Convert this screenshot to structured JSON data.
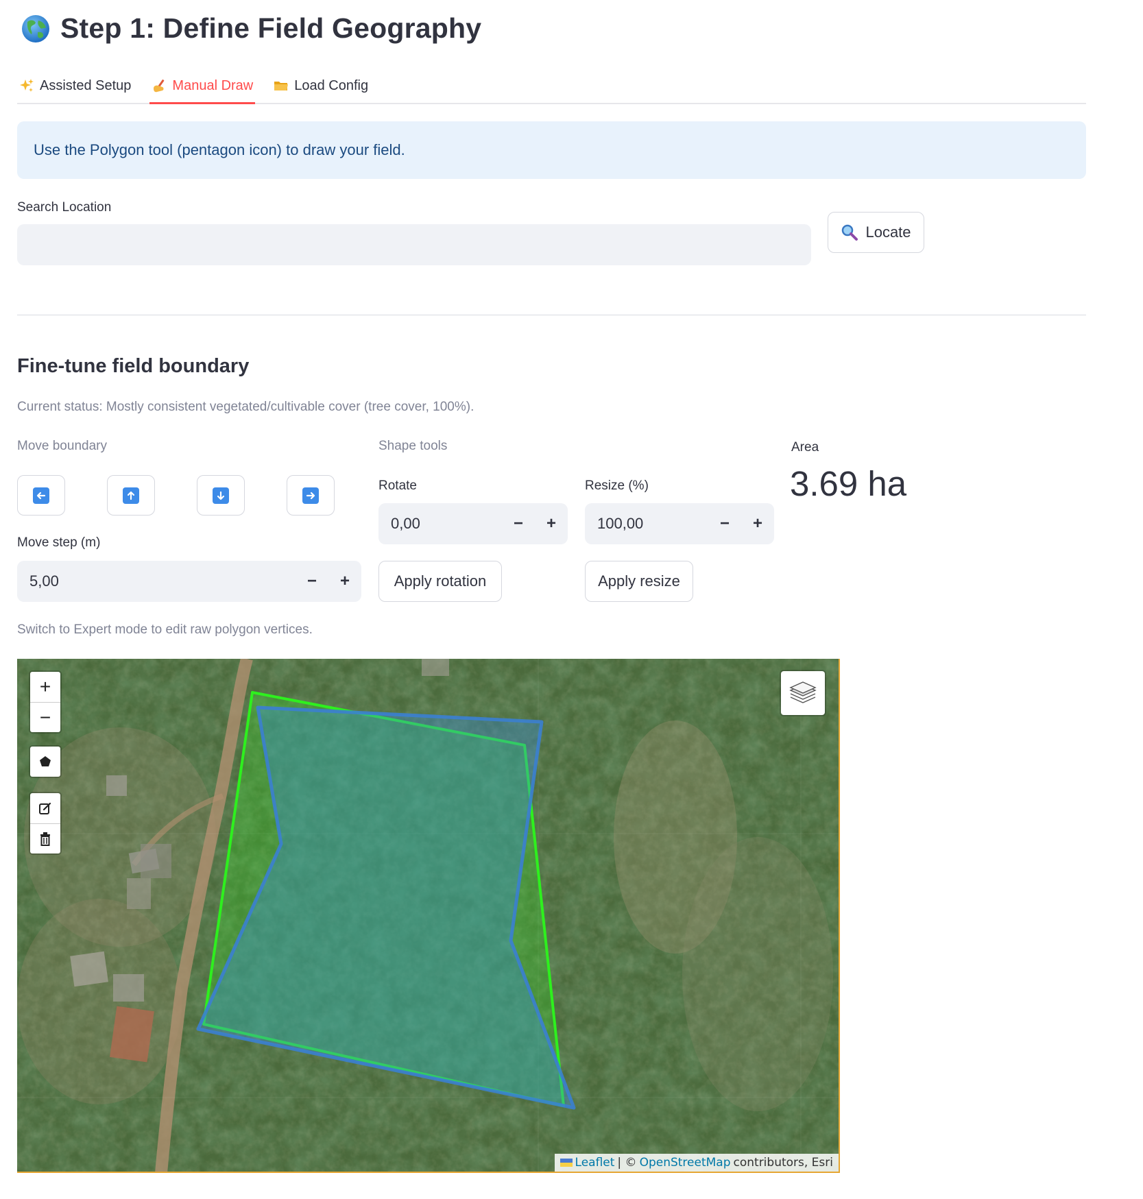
{
  "page": {
    "title": "Step 1: Define Field Geography"
  },
  "tabs": [
    {
      "label": "Assisted Setup",
      "icon": "sparkles-icon",
      "active": false
    },
    {
      "label": "Manual Draw",
      "icon": "writing-hand-icon",
      "active": true
    },
    {
      "label": "Load Config",
      "icon": "folder-icon",
      "active": false
    }
  ],
  "info": {
    "message": "Use the Polygon tool (pentagon icon) to draw your field."
  },
  "search": {
    "label": "Search Location",
    "value": "",
    "placeholder": "",
    "button_label": "Locate"
  },
  "finetune": {
    "title": "Fine-tune field boundary",
    "status": "Current status: Mostly consistent vegetated/cultivable cover (tree cover, 100%).",
    "move_label": "Move boundary",
    "move_step_label": "Move step (m)",
    "move_step_value": "5,00",
    "shape_tools_label": "Shape tools",
    "rotate_label": "Rotate",
    "rotate_value": "0,00",
    "resize_label": "Resize (%)",
    "resize_value": "100,00",
    "apply_rotation_label": "Apply rotation",
    "apply_resize_label": "Apply resize",
    "minus": "−",
    "plus": "+"
  },
  "area": {
    "label": "Area",
    "value": "3.69 ha"
  },
  "expert_hint": "Switch to Expert mode to edit raw polygon vertices.",
  "map": {
    "zoom_in": "+",
    "zoom_out": "−",
    "attribution": {
      "leaflet": "Leaflet",
      "separator": "| ©",
      "osm": "OpenStreetMap",
      "rest": "contributors, Esri"
    },
    "colors": {
      "drawn_polygon": "#2ef01e",
      "suggested_polygon": "#3b7fd0"
    }
  }
}
